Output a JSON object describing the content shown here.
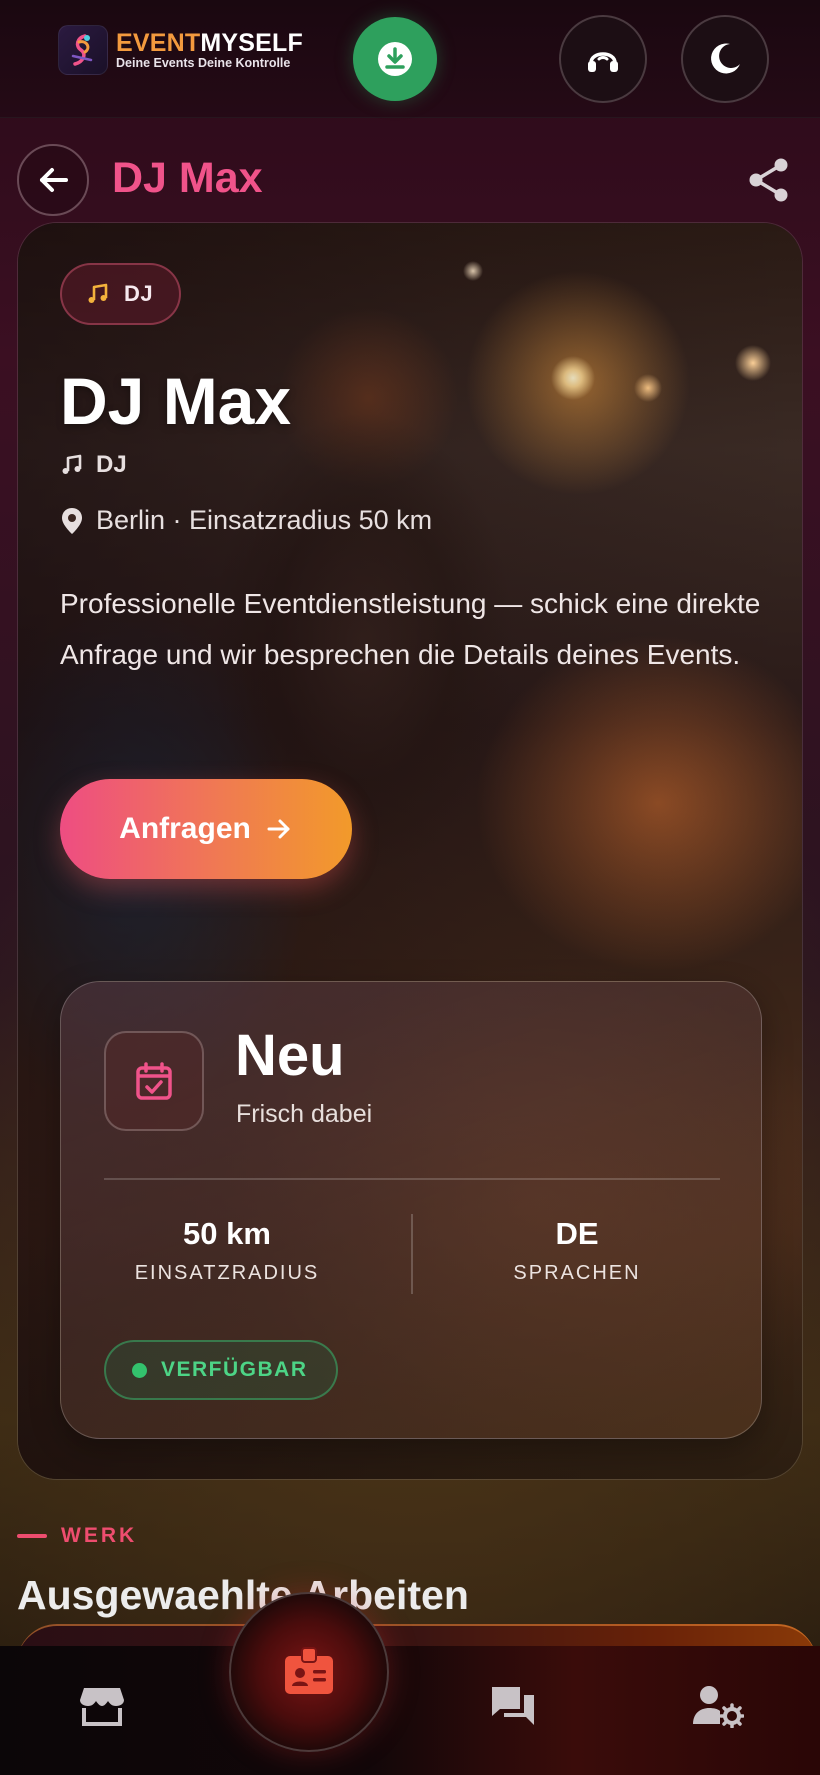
{
  "app": {
    "brand_part1": "EVENT",
    "brand_part2": "MYSELF",
    "tagline": "Deine Events Deine Kontrolle"
  },
  "icons": {
    "download": "download-icon",
    "support": "headset-icon",
    "theme": "moon-icon",
    "back": "arrow-left-icon",
    "share": "share-icon",
    "category": "music-note-icon",
    "location": "map-pin-icon",
    "cta": "arrow-right-icon",
    "status": "calendar-check-icon",
    "nav_shop": "store-icon",
    "nav_profile": "badge-icon",
    "nav_chat": "chat-icon",
    "nav_admin": "user-gear-icon"
  },
  "header": {
    "title": "DJ Max"
  },
  "hero": {
    "category_pill": "DJ",
    "name": "DJ Max",
    "category": "DJ",
    "location": "Berlin · Einsatzradius 50 km",
    "description": "Professionelle Eventdienstleistung — schick eine direkte Anfrage und wir besprechen die Details deines Events.",
    "cta_label": "Anfragen"
  },
  "stats": {
    "status_title": "Neu",
    "status_sub": "Frisch dabei",
    "radius_value": "50 km",
    "radius_label": "EINSATZRADIUS",
    "languages_value": "DE",
    "languages_label": "SPRACHEN",
    "availability": "VERFÜGBAR"
  },
  "section": {
    "kicker": "WERK",
    "title": "Ausgewaehlte Arbeiten"
  },
  "colors": {
    "accent_pink": "#f0538a",
    "accent_orange": "#f29a2a",
    "success_green": "#33c26d",
    "download_green": "#2ea05d"
  }
}
